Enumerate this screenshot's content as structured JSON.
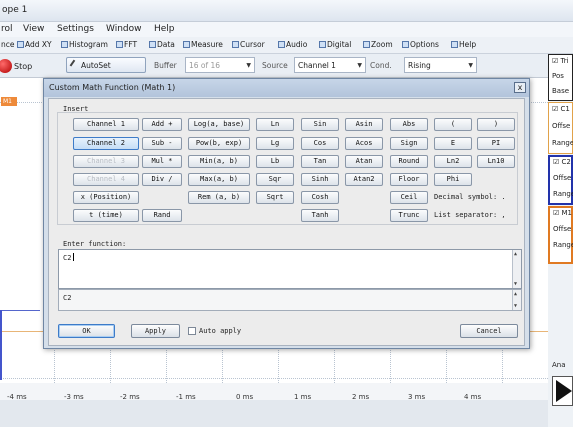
{
  "window": {
    "title": "ope 1"
  },
  "menu": [
    "rol",
    "View",
    "Settings",
    "Window",
    "Help"
  ],
  "toolbar": {
    "items": [
      "nce",
      "Add XY",
      "Histogram",
      "FFT",
      "Data",
      "Measure",
      "Cursor",
      "Audio",
      "Digital",
      "Zoom",
      "Options",
      "Help"
    ]
  },
  "controls": {
    "stop_label": "Stop",
    "autoset_label": "AutoSet",
    "buffer_label": "Buffer",
    "buffer_value": "16 of 16",
    "source_label": "Source",
    "source_value": "Channel 1",
    "cond_label": "Cond.",
    "cond_value": "Rising"
  },
  "scope": {
    "m1_tag": "M1",
    "x_ticks": [
      "-4 ms",
      "-3 ms",
      "-2 ms",
      "-1 ms",
      "0 ms",
      "1 ms",
      "2 ms",
      "3 ms",
      "4 ms"
    ]
  },
  "right_panel": {
    "trigger_label": "Tri",
    "pos_label": "Pos",
    "base_label": "Base",
    "c1_label": "C1",
    "c2_label": "C2",
    "m1_label": "M1",
    "offset_label": "Offse",
    "range_label": "Range",
    "analyze_label": "Ana"
  },
  "dialog": {
    "title": "Custom Math Function (Math 1)",
    "close_glyph": "x",
    "insert_label": "Insert",
    "buttons": {
      "channel1": "Channel 1",
      "channel2": "Channel 2",
      "channel3": "Channel 3",
      "channel4": "Channel 4",
      "x_position": "x (Position)",
      "t_time": "t (time)",
      "add": "Add +",
      "sub": "Sub -",
      "mul": "Mul *",
      "div": "Div /",
      "rand": "Rand",
      "log": "Log(a, base)",
      "pow": "Pow(b, exp)",
      "min": "Min(a, b)",
      "max": "Max(a, b)",
      "rem": "Rem (a, b)",
      "ln": "Ln",
      "lg": "Lg",
      "lb": "Lb",
      "sqr": "Sqr",
      "sqrt": "Sqrt",
      "sin": "Sin",
      "cos": "Cos",
      "tan": "Tan",
      "sinh": "Sinh",
      "cosh": "Cosh",
      "tanh": "Tanh",
      "asin": "Asin",
      "acos": "Acos",
      "atan": "Atan",
      "atan2": "Atan2",
      "abs": "Abs",
      "sign": "Sign",
      "round": "Round",
      "floor": "Floor",
      "ceil": "Ceil",
      "trunc": "Trunc",
      "lparen": "(",
      "e": "E",
      "ln2": "Ln2",
      "phi": "Phi",
      "rparen": ")",
      "pi": "PI",
      "ln10": "Ln10"
    },
    "decimal_symbol": "Decimal symbol: .",
    "list_separator": "List separator: ,",
    "enter_function_label": "Enter function:",
    "function_value": "C2",
    "preview_value": "C2",
    "ok_label": "OK",
    "apply_label": "Apply",
    "auto_apply_label": "Auto apply",
    "cancel_label": "Cancel"
  }
}
